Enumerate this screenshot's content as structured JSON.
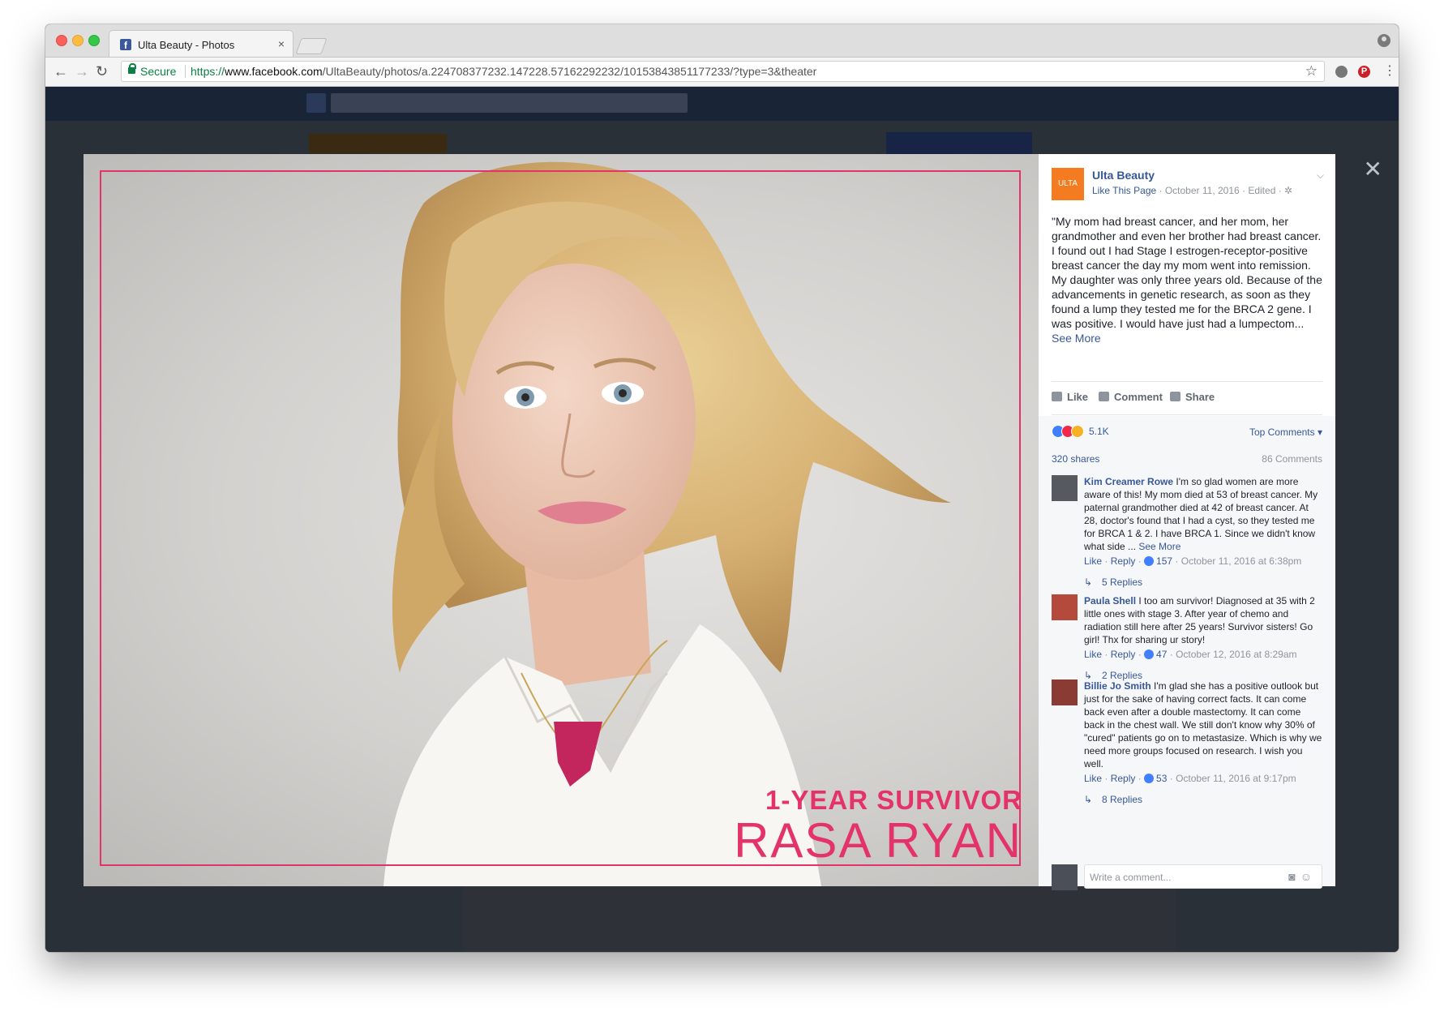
{
  "browser": {
    "tab_title": "Ulta Beauty - Photos",
    "tab_close": "×",
    "secure_label": "Secure",
    "url_scheme": "https://",
    "url_host": "www.facebook.com",
    "url_path": "/UltaBeauty/photos/a.224708377232.147228.57162292232/10153843851177233/?type=3&theater",
    "back": "←",
    "forward": "→",
    "reload": "↻",
    "bookmark": "☆",
    "menu": "⋮",
    "ext_pinterest": "P"
  },
  "theater": {
    "close": "✕"
  },
  "photo": {
    "line1": "1-YEAR SURVIVOR",
    "line2": "RASA RYAN",
    "accent_color": "#e4326a"
  },
  "post": {
    "page_avatar_text": "ULTA",
    "page_name": "Ulta Beauty",
    "like_page": "Like This Page",
    "meta": " · October 11, 2016 · Edited · ",
    "caption": "\"My mom had breast cancer, and her mom, her grandmother and even her brother had breast cancer. I found out I had Stage I estrogen-receptor-positive breast cancer the day my mom went into remission. My daughter was only three years old. Because of the advancements in genetic research, as soon as they found a lump they tested me for the BRCA 2 gene. I was positive. I would have just had a lumpectom...",
    "see_more": "See More",
    "actions": {
      "like": "Like",
      "comment": "Comment",
      "share": "Share"
    },
    "reaction_count": "5.1K",
    "top_comments": "Top Comments ▾",
    "shares": "320 shares",
    "comments_count": "86 Comments"
  },
  "comments": [
    {
      "name": "Kim Creamer Rowe",
      "text": " I'm so glad women are more aware of this! My mom died at 53 of breast cancer. My paternal grandmother died at 42 of breast cancer. At 28, doctor's found that I had a cyst, so they tested me for BRCA 1 & 2. I have BRCA 1. Since we didn't know what side ...",
      "see_more": " See More",
      "like": "Like",
      "reply": "Reply",
      "likes": "157",
      "time": " · October 11, 2016 at 6:38pm",
      "replies": "5 Replies"
    },
    {
      "name": "Paula Shell",
      "text": " I too am survivor! Diagnosed at 35 with 2 little ones with stage 3. After year of chemo and radiation still here after 25 years! Survivor sisters! Go girl! Thx for sharing ur story!",
      "see_more": "",
      "like": "Like",
      "reply": "Reply",
      "likes": "47",
      "time": " · October 12, 2016 at 8:29am",
      "replies": "2 Replies"
    },
    {
      "name": "Billie Jo Smith",
      "text": " I'm glad she has a positive outlook but just for the sake of having correct facts. It can come back even after a double mastectomy. It can come back in the chest wall. We still don't know why 30% of \"cured\" patients go on to metastasize. Which is why we need more groups focused on research. I wish you well.",
      "see_more": "",
      "like": "Like",
      "reply": "Reply",
      "likes": "53",
      "time": " · October 11, 2016 at 9:17pm",
      "replies": "8 Replies"
    }
  ],
  "write_comment": {
    "placeholder": "Write a comment...",
    "icons": "◙☺"
  },
  "colors": {
    "facebook_blue": "#365899",
    "secure_green": "#0b8043",
    "ulta_orange": "#f47b20"
  }
}
